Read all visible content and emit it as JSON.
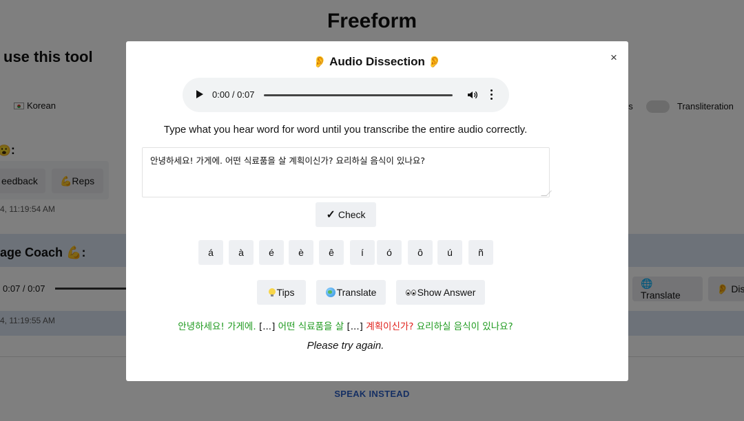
{
  "background": {
    "app_title": "Freeform",
    "how_to_heading": "use this tool",
    "language": "Korean",
    "toggle_partial_label": "es",
    "transliteration_label": "Transliteration",
    "section_heading": ":",
    "feedback_label": "eedback",
    "reps_label": "💪Reps",
    "timestamp_1": "4, 11:19:54 AM",
    "coach_heading": "age Coach 💪:",
    "player_time": "0:07 / 0:07",
    "translate_label": "🌐 Translate",
    "dis_label": "👂 Dis",
    "timestamp_2": "4, 11:19:55 AM",
    "speak_instead": "SPEAK INSTEAD"
  },
  "modal": {
    "title": "Audio Dissection",
    "close_label": "×",
    "audio": {
      "time": "0:00 / 0:07"
    },
    "instruction": "Type what you hear word for word until you transcribe the entire audio correctly.",
    "answer_value": "안녕하세요! 가게에. 어떤 식료품을 살 계획이신가? 요리하실 음식이 있나요?",
    "check_label": "Check",
    "accent_chars": [
      "á",
      "à",
      "é",
      "è",
      "ê",
      "í",
      "ó",
      "ô",
      "ú",
      "ñ"
    ],
    "tips_label": "Tips",
    "translate_label": "Translate",
    "show_answer_label": "Show Answer",
    "result": {
      "part1": "안녕하세요! 가게에.",
      "gap1": "[...]",
      "part2": "어떤 식료품을 살",
      "gap2": "[...]",
      "wrong": "계획이신가?",
      "part3": "요리하실 음식이 있나요?"
    },
    "retry_text": "Please try again."
  },
  "colors": {
    "correct": "#1e9a1e",
    "incorrect": "#e0201a",
    "link": "#2b5fc7",
    "overlay": "rgba(0,0,0,0.5)"
  }
}
